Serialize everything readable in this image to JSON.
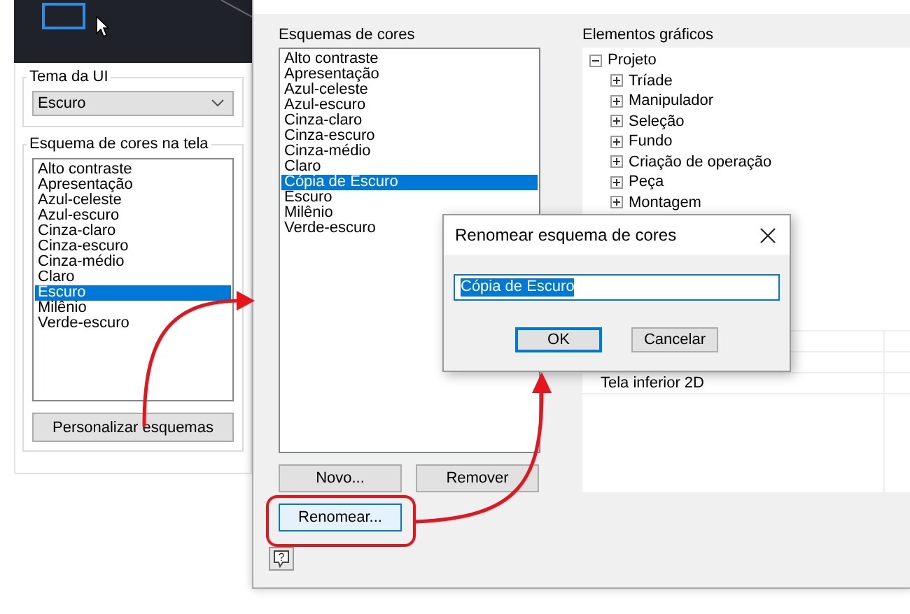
{
  "left_panel": {
    "ui_theme": {
      "label": "Tema da UI",
      "value": "Escuro"
    },
    "screen_scheme": {
      "label": "Esquema de cores na tela",
      "items": [
        {
          "label": "Alto contraste",
          "selected": false
        },
        {
          "label": "Apresentação",
          "selected": false
        },
        {
          "label": "Azul-celeste",
          "selected": false
        },
        {
          "label": "Azul-escuro",
          "selected": false
        },
        {
          "label": "Cinza-claro",
          "selected": false
        },
        {
          "label": "Cinza-escuro",
          "selected": false
        },
        {
          "label": "Cinza-médio",
          "selected": false
        },
        {
          "label": "Claro",
          "selected": false
        },
        {
          "label": "Escuro",
          "selected": true
        },
        {
          "label": "Milênio",
          "selected": false
        },
        {
          "label": "Verde-escuro",
          "selected": false
        }
      ],
      "button": "Personalizar esquemas"
    }
  },
  "editor": {
    "schemes_label": "Esquemas de cores",
    "schemes": [
      {
        "label": "Alto contraste",
        "selected": false
      },
      {
        "label": "Apresentação",
        "selected": false
      },
      {
        "label": "Azul-celeste",
        "selected": false
      },
      {
        "label": "Azul-escuro",
        "selected": false
      },
      {
        "label": "Cinza-claro",
        "selected": false
      },
      {
        "label": "Cinza-escuro",
        "selected": false
      },
      {
        "label": "Cinza-médio",
        "selected": false
      },
      {
        "label": "Claro",
        "selected": false
      },
      {
        "label": "Cópia de Escuro",
        "selected": true
      },
      {
        "label": "Escuro",
        "selected": false
      },
      {
        "label": "Milênio",
        "selected": false
      },
      {
        "label": "Verde-escuro",
        "selected": false
      }
    ],
    "buttons": [
      {
        "label": "Novo...",
        "hovered": false
      },
      {
        "label": "Remover",
        "hovered": false
      },
      {
        "label": "Renomear...",
        "hovered": true
      }
    ],
    "elements_label": "Elementos gráficos",
    "tree": [
      {
        "label": "Projeto",
        "expanded": true,
        "children": [
          {
            "label": "Tríade",
            "expanded": false
          },
          {
            "label": "Manipulador",
            "expanded": false
          },
          {
            "label": "Seleção",
            "expanded": false
          },
          {
            "label": "Fundo",
            "expanded": false
          },
          {
            "label": "Criação de operação",
            "expanded": false
          },
          {
            "label": "Peça",
            "expanded": false
          },
          {
            "label": "Montagem",
            "expanded": false
          }
        ]
      }
    ],
    "table_rows": [
      "Tela inferior 2D"
    ],
    "help_glyph": "?"
  },
  "rename_dialog": {
    "title": "Renomear esquema de cores",
    "value": "Cópia de Escuro",
    "buttons": [
      {
        "label": "OK",
        "default": true
      },
      {
        "label": "Cancelar",
        "default": false
      }
    ]
  }
}
